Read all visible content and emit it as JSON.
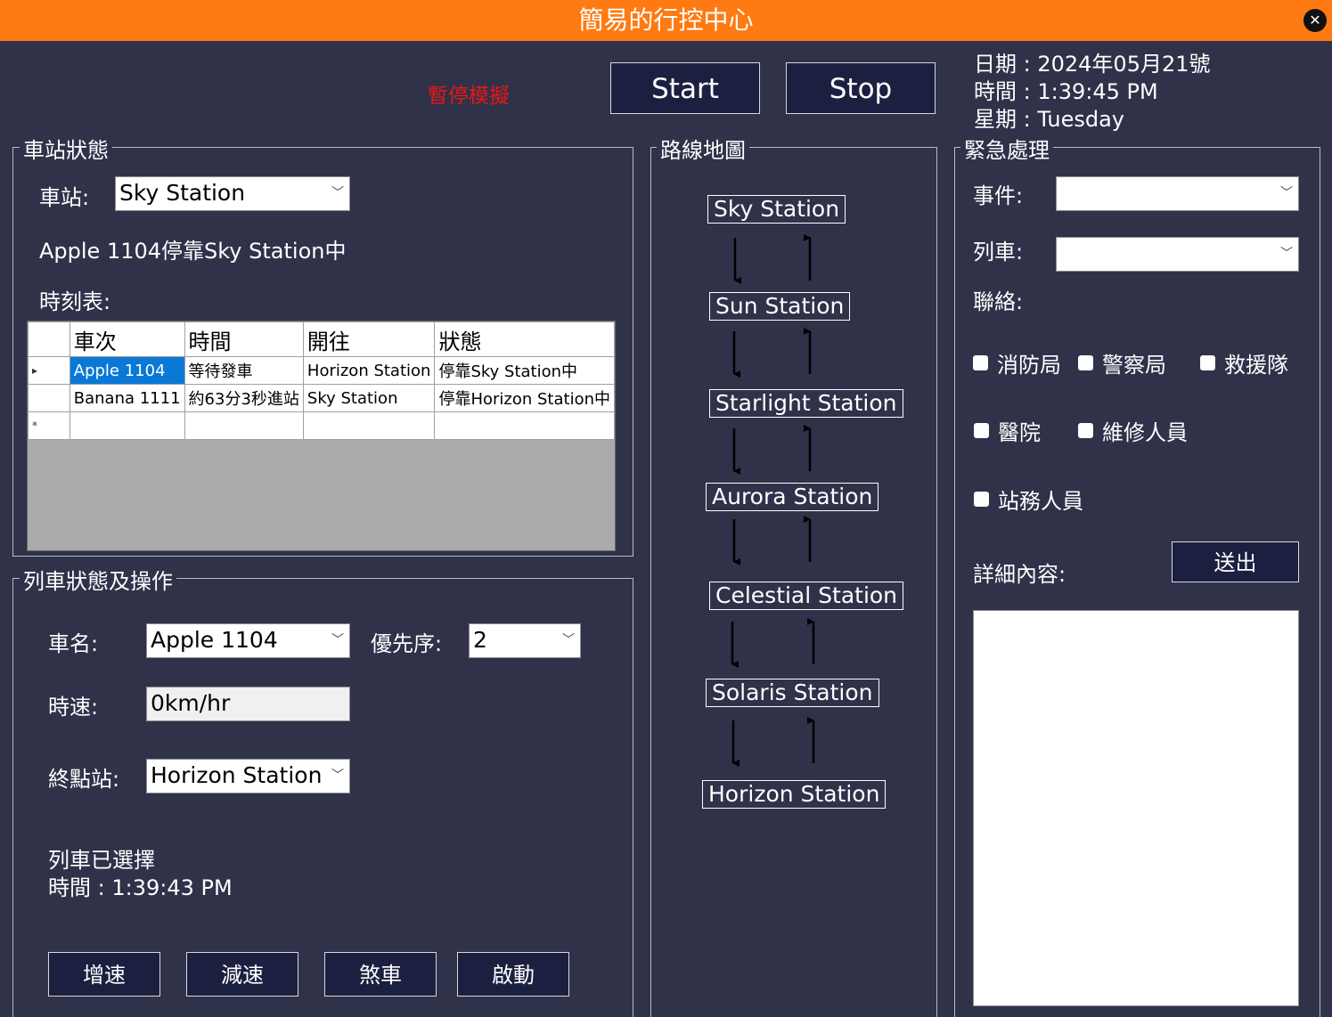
{
  "window": {
    "title": "簡易的行控中心",
    "close_glyph": "✕"
  },
  "header": {
    "pause_text": "暫停模擬",
    "start_label": "Start",
    "stop_label": "Stop",
    "date": "日期 : 2024年05月21號",
    "time": "時間 : 1:39:45 PM",
    "weekday": "星期 : Tuesday"
  },
  "station_panel": {
    "title": "車站狀態",
    "station_label": "車站:",
    "station_value": "Sky Station",
    "status_text": "Apple 1104停靠Sky Station中",
    "timetable_label": "時刻表:",
    "timetable": {
      "columns": [
        "車次",
        "時間",
        "開往",
        "狀態"
      ],
      "rows": [
        [
          "Apple 1104",
          "等待發車",
          "Horizon Station",
          "停靠Sky Station中"
        ],
        [
          "Banana 1111",
          "約63分3秒進站",
          "Sky Station",
          "停靠Horizon Station中"
        ]
      ],
      "current_row_marker": "▸",
      "new_row_marker": "*"
    }
  },
  "train_panel": {
    "title": "列車狀態及操作",
    "name_label": "車名:",
    "name_value": "Apple 1104",
    "priority_label": "優先序:",
    "priority_value": "2",
    "speed_label": "時速:",
    "speed_value": "0km/hr",
    "terminal_label": "終點站:",
    "terminal_value": "Horizon Station",
    "selected_text": "列車已選擇",
    "selected_time": "時間 : 1:39:43 PM",
    "buttons": [
      "增速",
      "減速",
      "煞車",
      "啟動"
    ]
  },
  "route_panel": {
    "title": "路線地圖",
    "stations": [
      "Sky Station",
      "Sun Station",
      "Starlight Station",
      "Aurora Station",
      "Celestial Station",
      "Solaris Station",
      "Horizon Station"
    ]
  },
  "emergency_panel": {
    "title": "緊急處理",
    "event_label": "事件:",
    "event_value": "",
    "train_label": "列車:",
    "train_value": "",
    "contact_label": "聯絡:",
    "contacts": [
      "消防局",
      "警察局",
      "救援隊",
      "醫院",
      "維修人員",
      "站務人員"
    ],
    "detail_label": "詳細內容:",
    "send_label": "送出",
    "detail_value": ""
  },
  "icons": {
    "dropdown": "chevron-down-icon",
    "close": "close-icon",
    "arrow_down": "arrow-down-icon",
    "arrow_up": "arrow-up-icon"
  },
  "colors": {
    "background": "#2f3249",
    "titlebar": "#ff7a12",
    "button": "#1c2040",
    "pause_text": "#e81616",
    "selection": "#0a78d7"
  }
}
